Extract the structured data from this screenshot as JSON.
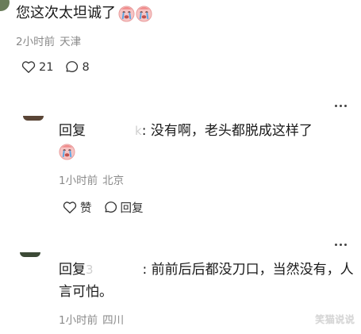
{
  "main_comment": {
    "text": "您这次太坦诚了",
    "emoji_names": [
      "crying-face-icon",
      "crying-face-icon"
    ],
    "time": "2小时前",
    "location": "天津",
    "like_count": "21",
    "comment_count": "8"
  },
  "replies": [
    {
      "prefix": "回复",
      "masked_tail": "k",
      "text": ": 没有啊，老头都脱成这样了",
      "emoji_name": "crying-face-icon",
      "time": "1小时前",
      "location": "北京",
      "like_label": "赞",
      "reply_label": "回复"
    },
    {
      "prefix": "回复",
      "masked_tail": "3",
      "text": ": 前前后后都没刀口，当然没有，人言可怕。",
      "time": "1小时前",
      "location": "四川"
    }
  ],
  "watermark": "笑猫说说",
  "colors": {
    "text": "#191919",
    "meta": "#8a8a8a",
    "emoji_face": "#f6b8b8",
    "tear": "#5aa8e6"
  }
}
